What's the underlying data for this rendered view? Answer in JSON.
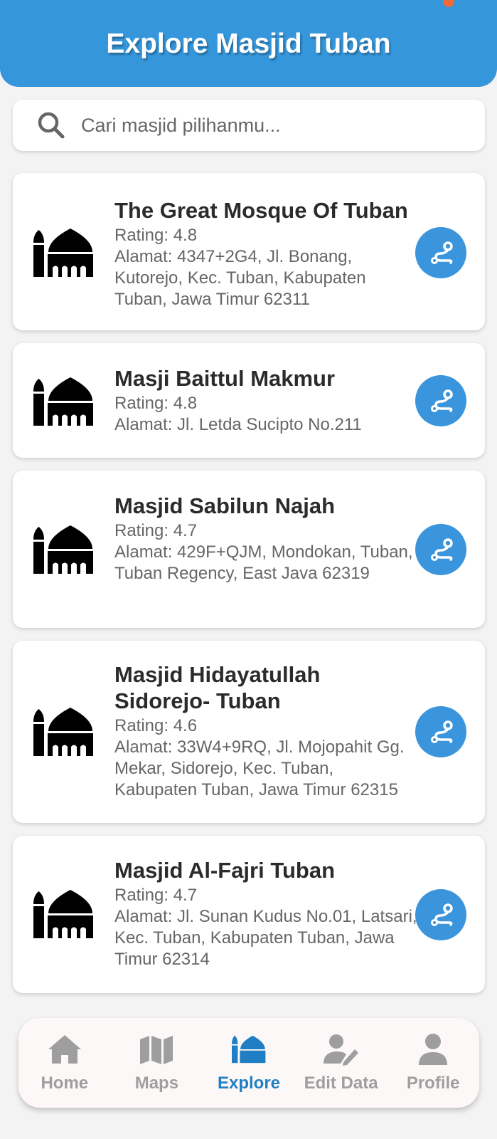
{
  "header": {
    "title": "Explore Masjid Tuban"
  },
  "search": {
    "placeholder": "Cari masjid pilihanmu..."
  },
  "mosques": [
    {
      "name": "The Great Mosque Of Tuban",
      "rating": "Rating: 4.8",
      "address": "Alamat: 4347+2G4, Jl. Bonang, Kutorejo, Kec. Tuban, Kabupaten Tuban, Jawa Timur 62311"
    },
    {
      "name": "Masji Baittul Makmur",
      "rating": "Rating: 4.8",
      "address": "Alamat: Jl. Letda Sucipto No.211"
    },
    {
      "name": "Masjid Sabilun Najah",
      "rating": "Rating: 4.7",
      "address": "Alamat: 429F+QJM, Mondokan, Tuban, Tuban Regency, East Java 62319"
    },
    {
      "name": "Masjid Hidayatullah Sidorejo- Tuban",
      "rating": "Rating: 4.6",
      "address": "Alamat: 33W4+9RQ, Jl. Mojopahit Gg. Mekar, Sidorejo, Kec. Tuban, Kabupaten Tuban, Jawa Timur 62315"
    },
    {
      "name": "Masjid Al-Fajri Tuban",
      "rating": "Rating: 4.7",
      "address": "Alamat: Jl. Sunan Kudus No.01, Latsari, Kec. Tuban, Kabupaten Tuban, Jawa Timur 62314"
    }
  ],
  "nav": {
    "items": [
      {
        "label": "Home",
        "icon": "home-icon"
      },
      {
        "label": "Maps",
        "icon": "map-icon"
      },
      {
        "label": "Explore",
        "icon": "mosque-icon",
        "active": true
      },
      {
        "label": "Edit Data",
        "icon": "user-edit-icon"
      },
      {
        "label": "Profile",
        "icon": "user-icon"
      }
    ]
  },
  "colors": {
    "primary": "#3596db",
    "active_nav": "#1f7ec4",
    "inactive_nav": "#9e9e9e"
  }
}
